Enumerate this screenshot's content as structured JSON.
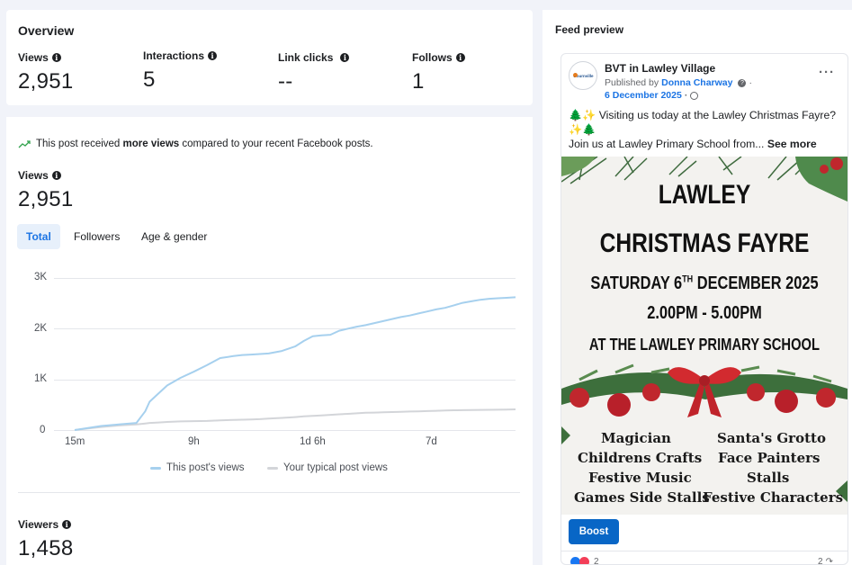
{
  "overview": {
    "title": "Overview",
    "metrics": [
      {
        "label": "Views",
        "value": "2,951"
      },
      {
        "label": "Interactions",
        "value": "5"
      },
      {
        "label": "Link clicks",
        "value": "--"
      },
      {
        "label": "Follows",
        "value": "1"
      }
    ]
  },
  "insight": {
    "prefix": "This post received ",
    "bold": "more views",
    "suffix": " compared to your recent Facebook posts."
  },
  "views": {
    "label": "Views",
    "value": "2,951"
  },
  "tabs": [
    "Total",
    "Followers",
    "Age & gender"
  ],
  "active_tab": "Total",
  "chart_data": {
    "type": "line",
    "x_tick_labels": [
      "15m",
      "9h",
      "1d 6h",
      "7d"
    ],
    "y_ticks": [
      0,
      1000,
      2000,
      3000
    ],
    "y_tick_labels": [
      "0",
      "1K",
      "2K",
      "3K"
    ],
    "ylim": [
      0,
      3000
    ],
    "grid": true,
    "legend_position": "bottom",
    "x_positions": [
      0,
      0.03,
      0.06,
      0.1,
      0.14,
      0.16,
      0.17,
      0.19,
      0.21,
      0.24,
      0.27,
      0.3,
      0.33,
      0.36,
      0.38,
      0.4,
      0.42,
      0.44,
      0.47,
      0.5,
      0.52,
      0.54,
      0.56,
      0.58,
      0.6,
      0.62,
      0.64,
      0.66,
      0.68,
      0.7,
      0.72,
      0.74,
      0.76,
      0.78,
      0.8,
      0.82,
      0.84,
      0.86,
      0.88,
      0.9,
      0.92,
      0.94,
      0.96,
      0.98,
      1.0
    ],
    "series": [
      {
        "name": "This post's views",
        "color": "#a6d0ee",
        "values": [
          0,
          40,
          80,
          110,
          140,
          370,
          560,
          720,
          880,
          1030,
          1150,
          1280,
          1420,
          1460,
          1480,
          1490,
          1500,
          1510,
          1560,
          1650,
          1760,
          1850,
          1870,
          1880,
          1960,
          2000,
          2040,
          2070,
          2110,
          2150,
          2190,
          2230,
          2260,
          2300,
          2340,
          2380,
          2410,
          2460,
          2510,
          2540,
          2570,
          2590,
          2600,
          2610,
          2620
        ]
      },
      {
        "name": "Your typical post views",
        "color": "#d3d5d9",
        "values": [
          0,
          30,
          60,
          90,
          110,
          130,
          140,
          150,
          160,
          170,
          175,
          180,
          190,
          200,
          205,
          210,
          215,
          225,
          240,
          255,
          270,
          280,
          290,
          300,
          310,
          320,
          330,
          340,
          345,
          350,
          355,
          360,
          365,
          370,
          375,
          380,
          385,
          390,
          392,
          395,
          398,
          400,
          402,
          405,
          408
        ]
      }
    ]
  },
  "viewers": {
    "label": "Viewers",
    "value": "1,458"
  },
  "feed": {
    "title": "Feed preview",
    "page_name": "BVT in Lawley Village",
    "published_by_prefix": "Published by ",
    "publisher": "Donna Charway",
    "date": "6 December 2025",
    "text_line1": "🌲✨ Visiting us today at the Lawley Christmas Fayre? ✨🌲",
    "text_line2_prefix": "Join us at Lawley Primary School from... ",
    "see_more": "See more",
    "boost_label": "Boost",
    "reactions_count": "2",
    "shares_count": "2",
    "avatar_text": "Bournville"
  },
  "poster": {
    "line1": "LAWLEY",
    "line2": "CHRISTMAS FAYRE",
    "line3_a": "SATURDAY 6",
    "line3_sup": "TH",
    "line3_b": " DECEMBER 2025",
    "line4": "2.00PM - 5.00PM",
    "line5": "AT THE LAWLEY  PRIMARY SCHOOL",
    "attractions_left": [
      "Magician",
      "Childrens Crafts",
      "Festive Music",
      "Games Side Stalls"
    ],
    "attractions_right": [
      "Santa's Grotto",
      "Face Painters",
      "Stalls",
      "Festive Characters"
    ]
  }
}
